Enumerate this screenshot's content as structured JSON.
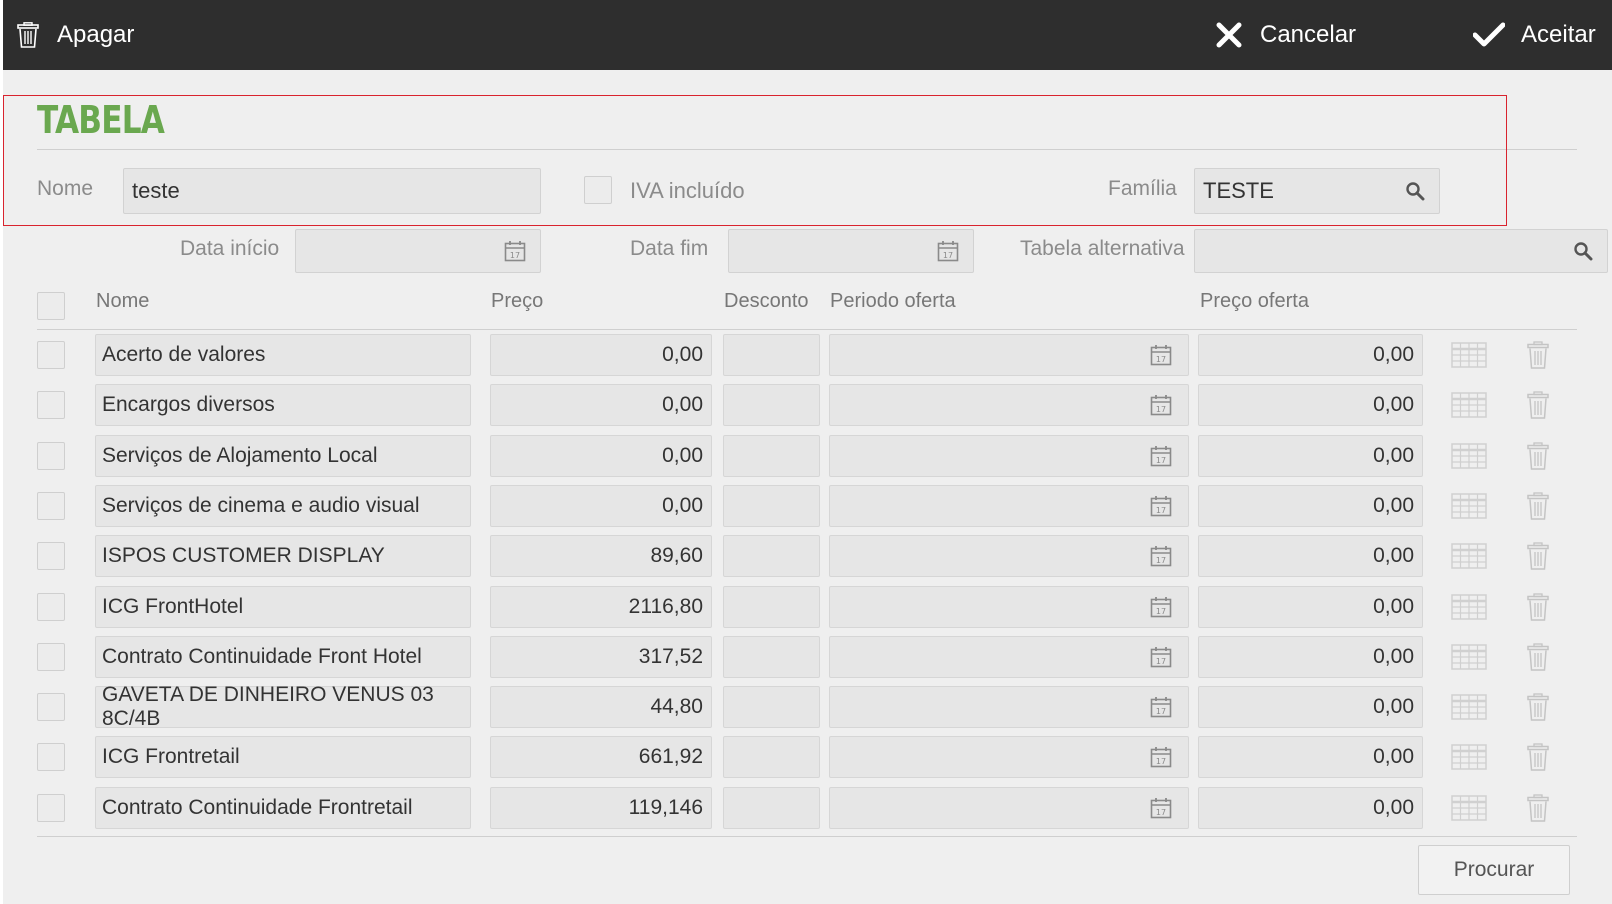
{
  "toolbar": {
    "delete_label": "Apagar",
    "cancel_label": "Cancelar",
    "accept_label": "Aceitar"
  },
  "form": {
    "title": "TABELA",
    "name_label": "Nome",
    "name_value": "teste",
    "vat_label": "IVA incluído",
    "vat_checked": false,
    "family_label": "Família",
    "family_value": "TESTE",
    "start_date_label": "Data início",
    "start_date_value": "",
    "end_date_label": "Data fim",
    "end_date_value": "",
    "alt_table_label": "Tabela alternativa",
    "alt_table_value": ""
  },
  "table": {
    "headers": {
      "name": "Nome",
      "price": "Preço",
      "discount": "Desconto",
      "offer_period": "Periodo oferta",
      "offer_price": "Preço oferta"
    },
    "rows": [
      {
        "name": "Acerto de valores",
        "price": "0,00",
        "discount": "",
        "offer_period": "",
        "offer_price": "0,00"
      },
      {
        "name": "Encargos diversos",
        "price": "0,00",
        "discount": "",
        "offer_period": "",
        "offer_price": "0,00"
      },
      {
        "name": "Serviços de Alojamento Local",
        "price": "0,00",
        "discount": "",
        "offer_period": "",
        "offer_price": "0,00"
      },
      {
        "name": "Serviços de cinema e audio visual",
        "price": "0,00",
        "discount": "",
        "offer_period": "",
        "offer_price": "0,00"
      },
      {
        "name": "ISPOS CUSTOMER DISPLAY",
        "price": "89,60",
        "discount": "",
        "offer_period": "",
        "offer_price": "0,00"
      },
      {
        "name": "ICG FrontHotel",
        "price": "2116,80",
        "discount": "",
        "offer_period": "",
        "offer_price": "0,00"
      },
      {
        "name": "Contrato Continuidade Front Hotel",
        "price": "317,52",
        "discount": "",
        "offer_period": "",
        "offer_price": "0,00"
      },
      {
        "name": "GAVETA DE DINHEIRO VENUS 03 8C/4B",
        "price": "44,80",
        "discount": "",
        "offer_period": "",
        "offer_price": "0,00"
      },
      {
        "name": "ICG Frontretail",
        "price": "661,92",
        "discount": "",
        "offer_period": "",
        "offer_price": "0,00"
      },
      {
        "name": "Contrato Continuidade Frontretail",
        "price": "119,146",
        "discount": "",
        "offer_period": "",
        "offer_price": "0,00"
      }
    ]
  },
  "footer": {
    "search_label": "Procurar"
  },
  "colors": {
    "topbar": "#2e2e2e",
    "title": "#6aa84f",
    "highlight": "#d9232e",
    "background": "#efefef"
  },
  "icons": {
    "delete": "trash-icon",
    "cancel": "close-icon",
    "accept": "check-icon",
    "search": "search-icon",
    "calendar": "calendar-icon",
    "grid": "grid-icon"
  }
}
